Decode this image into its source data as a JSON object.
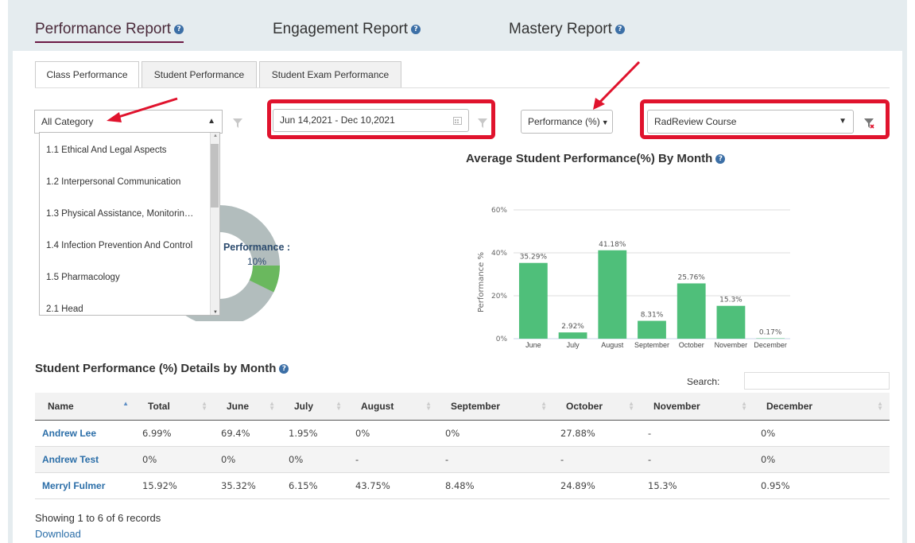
{
  "nav": {
    "tabs": [
      {
        "label": "Performance Report",
        "active": true
      },
      {
        "label": "Engagement Report",
        "active": false
      },
      {
        "label": "Mastery Report",
        "active": false
      }
    ]
  },
  "subtabs": [
    "Class Performance",
    "Student Performance",
    "Student Exam Performance"
  ],
  "filters": {
    "category": "All Category",
    "date_range": "Jun 14,2021 - Dec 10,2021",
    "metric": "Performance (%)",
    "course": "RadReview Course"
  },
  "category_options": [
    "1.1 Ethical And Legal Aspects",
    "1.2 Interpersonal Communication",
    "1.3 Physical Assistance, Monitorin…",
    "1.4 Infection Prevention And Control",
    "1.5 Pharmacology",
    "2.1 Head"
  ],
  "donut": {
    "label": "Performance :",
    "value_text": "10%",
    "value": 10,
    "colors": {
      "rest": "#b2bdbd",
      "perf": "#6ab85e"
    }
  },
  "chart_data": {
    "type": "bar",
    "title": "Average Student Performance(%) By Month",
    "ylabel": "Performance %",
    "categories": [
      "June",
      "July",
      "August",
      "September",
      "October",
      "November",
      "December"
    ],
    "values": [
      35.29,
      2.92,
      41.18,
      8.31,
      25.76,
      15.3,
      0.17
    ],
    "value_labels": [
      "35.29%",
      "2.92%",
      "41.18%",
      "8.31%",
      "25.76%",
      "15.3%",
      "0.17%"
    ],
    "yticks": [
      "0%",
      "20%",
      "40%",
      "60%"
    ],
    "ylim": [
      0,
      60
    ],
    "grid": true,
    "color": "#4fbf7a"
  },
  "table": {
    "title": "Student Performance (%) Details by Month",
    "search_label": "Search:",
    "columns": [
      "Name",
      "Total",
      "June",
      "July",
      "August",
      "September",
      "October",
      "November",
      "December"
    ],
    "rows": [
      [
        "Andrew Lee",
        "6.99%",
        "69.4%",
        "1.95%",
        "0%",
        "0%",
        "27.88%",
        "-",
        "0%"
      ],
      [
        "Andrew Test",
        "0%",
        "0%",
        "0%",
        "-",
        "-",
        "-",
        "-",
        "0%"
      ],
      [
        "Merryl Fulmer",
        "15.92%",
        "35.32%",
        "6.15%",
        "43.75%",
        "8.48%",
        "24.89%",
        "15.3%",
        "0.95%"
      ]
    ],
    "footer": "Showing 1 to 6 of 6 records",
    "download": "Download"
  },
  "colors": {
    "accent_red": "#e0132d",
    "link": "#2b6ea8",
    "bar": "#4fbf7a"
  }
}
